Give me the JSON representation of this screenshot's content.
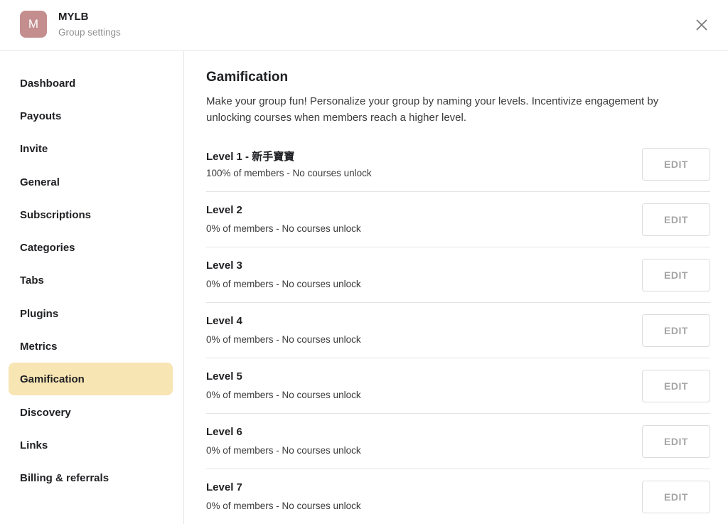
{
  "header": {
    "avatar_letter": "M",
    "group_name": "MYLB",
    "subtitle": "Group settings",
    "close_icon": "close-icon"
  },
  "sidebar": {
    "items": [
      {
        "label": "Dashboard",
        "active": false
      },
      {
        "label": "Payouts",
        "active": false
      },
      {
        "label": "Invite",
        "active": false
      },
      {
        "label": "General",
        "active": false
      },
      {
        "label": "Subscriptions",
        "active": false
      },
      {
        "label": "Categories",
        "active": false
      },
      {
        "label": "Tabs",
        "active": false
      },
      {
        "label": "Plugins",
        "active": false
      },
      {
        "label": "Metrics",
        "active": false
      },
      {
        "label": "Gamification",
        "active": true
      },
      {
        "label": "Discovery",
        "active": false
      },
      {
        "label": "Links",
        "active": false
      },
      {
        "label": "Billing & referrals",
        "active": false
      }
    ]
  },
  "main": {
    "title": "Gamification",
    "description": "Make your group fun! Personalize your group by naming your levels. Incentivize engagement by unlocking courses when members reach a higher level.",
    "levels": [
      {
        "name": "Level 1 - 新手寶寶",
        "info": "100% of members - No courses unlock",
        "button": "EDIT"
      },
      {
        "name": "Level 2",
        "info": "0% of members - No courses unlock",
        "button": "EDIT"
      },
      {
        "name": "Level 3",
        "info": "0% of members - No courses unlock",
        "button": "EDIT"
      },
      {
        "name": "Level 4",
        "info": "0% of members - No courses unlock",
        "button": "EDIT"
      },
      {
        "name": "Level 5",
        "info": "0% of members - No courses unlock",
        "button": "EDIT"
      },
      {
        "name": "Level 6",
        "info": "0% of members - No courses unlock",
        "button": "EDIT"
      },
      {
        "name": "Level 7",
        "info": "0% of members - No courses unlock",
        "button": "EDIT"
      }
    ]
  },
  "colors": {
    "avatar": "#c48e8e",
    "active_nav": "#f8e5b4",
    "divider": "#e4e4e4",
    "edit_text": "#a5a5a5"
  }
}
